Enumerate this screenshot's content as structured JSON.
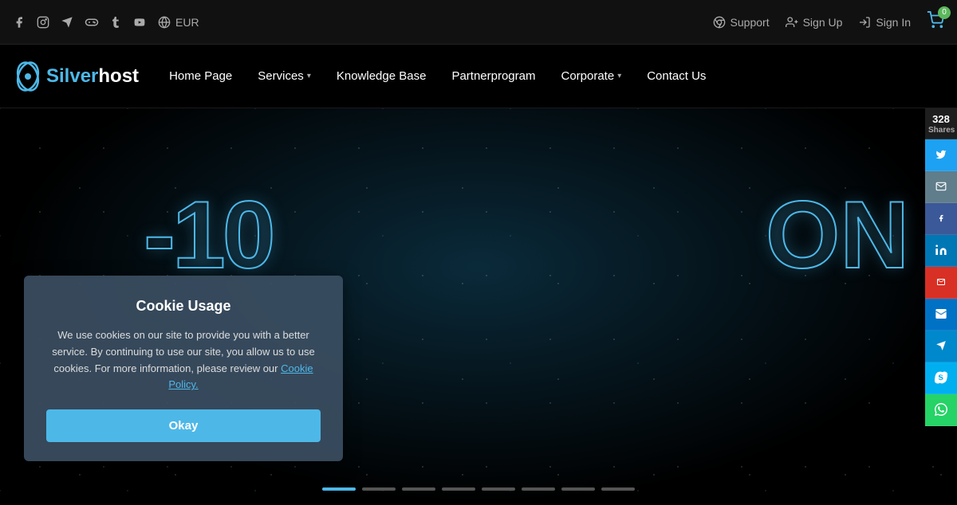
{
  "topbar": {
    "currency": "EUR",
    "support_label": "Support",
    "signup_label": "Sign Up",
    "signin_label": "Sign In",
    "cart_count": "0"
  },
  "nav": {
    "logo_silver": "Silver",
    "logo_host": "host",
    "items": [
      {
        "label": "Home Page",
        "has_dropdown": false
      },
      {
        "label": "Services",
        "has_dropdown": true
      },
      {
        "label": "Knowledge Base",
        "has_dropdown": false
      },
      {
        "label": "Partnerprogram",
        "has_dropdown": false
      },
      {
        "label": "Corporate",
        "has_dropdown": true
      },
      {
        "label": "Contact Us",
        "has_dropdown": false
      }
    ]
  },
  "hero": {
    "text_left": "-10",
    "text_right": "ON"
  },
  "slider": {
    "dots_count": 8,
    "active_index": 0
  },
  "share": {
    "count": "328",
    "label": "Shares"
  },
  "share_buttons": [
    {
      "name": "twitter",
      "icon": "🐦",
      "class": "twitter"
    },
    {
      "name": "email",
      "icon": "✉",
      "class": "email"
    },
    {
      "name": "facebook",
      "icon": "f",
      "class": "facebook"
    },
    {
      "name": "linkedin",
      "icon": "in",
      "class": "linkedin"
    },
    {
      "name": "gmail",
      "icon": "M",
      "class": "gmail"
    },
    {
      "name": "outlook",
      "icon": "O",
      "class": "outlook"
    },
    {
      "name": "telegram",
      "icon": "✈",
      "class": "telegram"
    },
    {
      "name": "skype",
      "icon": "S",
      "class": "skype"
    },
    {
      "name": "whatsapp",
      "icon": "W",
      "class": "whatsapp"
    }
  ],
  "cookie": {
    "title": "Cookie Usage",
    "body": "We use cookies on our site to provide you with a better service. By continuing to use our site, you allow us to use cookies. For more information, please review our",
    "link_text": "Cookie Policy.",
    "ok_label": "Okay"
  }
}
